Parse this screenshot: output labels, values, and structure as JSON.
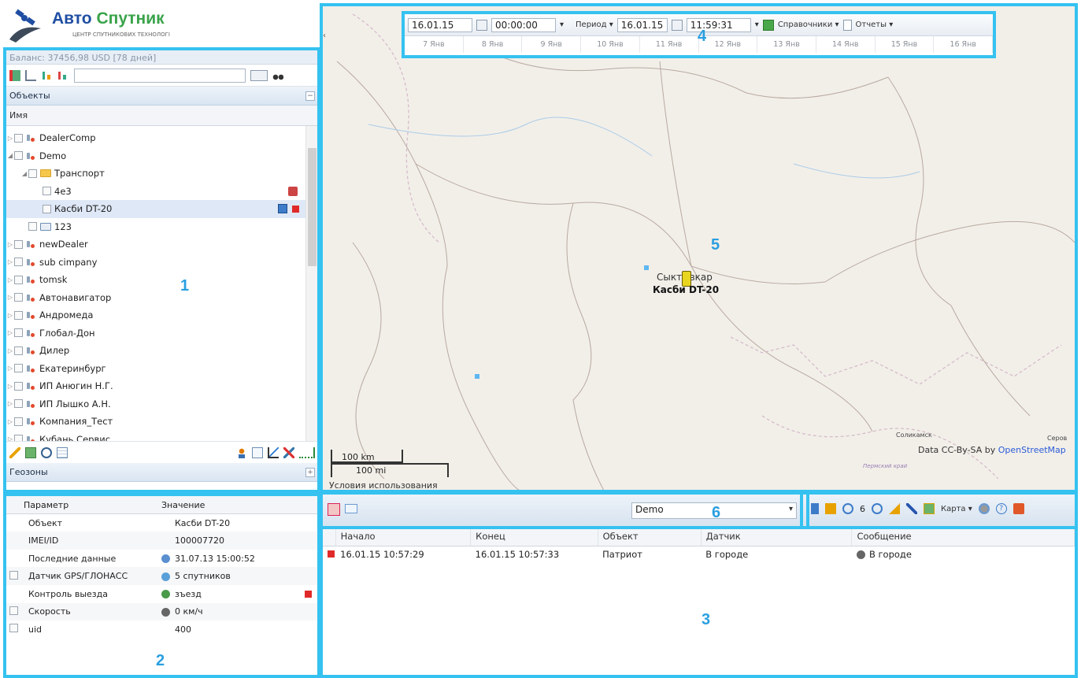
{
  "logo": {
    "brand_a": "Авто",
    "brand_b": "Спутник",
    "tagline": "ЦЕНТР СПУТНИКОВИХ ТЕХНОЛОГІ"
  },
  "left_panel": {
    "balance": "Баланс: 37456,98 USD [78 дней]",
    "objects_header": "Объекты",
    "column_name": "Имя",
    "geozones_header": "Геозоны",
    "tree": [
      {
        "label": "DealerComp",
        "level": 0,
        "arrow": "▷",
        "icon": "object"
      },
      {
        "label": "Demo",
        "level": 0,
        "arrow": "◢",
        "icon": "object"
      },
      {
        "label": "Транспорт",
        "level": 1,
        "arrow": "◢",
        "icon": "folder"
      },
      {
        "label": "4e3",
        "level": 2,
        "arrow": "",
        "icon": "none"
      },
      {
        "label": "Касби DT-20",
        "level": 2,
        "arrow": "",
        "icon": "none",
        "selected": true
      },
      {
        "label": "123",
        "level": 1,
        "arrow": "",
        "icon": "list"
      },
      {
        "label": "newDealer",
        "level": 0,
        "arrow": "▷",
        "icon": "object"
      },
      {
        "label": "sub cimpany",
        "level": 0,
        "arrow": "▷",
        "icon": "object"
      },
      {
        "label": "tomsk",
        "level": 0,
        "arrow": "▷",
        "icon": "object"
      },
      {
        "label": "Автонавигатор",
        "level": 0,
        "arrow": "▷",
        "icon": "object"
      },
      {
        "label": "Андромеда",
        "level": 0,
        "arrow": "▷",
        "icon": "object"
      },
      {
        "label": "Глобал-Дон",
        "level": 0,
        "arrow": "▷",
        "icon": "object"
      },
      {
        "label": "Дилер",
        "level": 0,
        "arrow": "▷",
        "icon": "object"
      },
      {
        "label": "Екатеринбург",
        "level": 0,
        "arrow": "▷",
        "icon": "object"
      },
      {
        "label": "ИП Анюгин Н.Г.",
        "level": 0,
        "arrow": "▷",
        "icon": "object"
      },
      {
        "label": "ИП Лышко А.Н.",
        "level": 0,
        "arrow": "▷",
        "icon": "object"
      },
      {
        "label": "Компания_Тест",
        "level": 0,
        "arrow": "▷",
        "icon": "object"
      },
      {
        "label": "Кубань Сервис",
        "level": 0,
        "arrow": "▷",
        "icon": "object"
      }
    ]
  },
  "params": {
    "col_param": "Параметр",
    "col_value": "Значение",
    "rows": [
      {
        "name": "Объект",
        "value": "Касби DT-20",
        "check": false
      },
      {
        "name": "IMEI/ID",
        "value": "100007720",
        "check": false
      },
      {
        "name": "Последние данные",
        "value": "31.07.13 15:00:52",
        "check": false
      },
      {
        "name": "Датчик GPS/ГЛОНАСС",
        "value": "5 спутников",
        "check": true
      },
      {
        "name": "Контроль выезда",
        "value": "зъезд",
        "check": false
      },
      {
        "name": "Скорость",
        "value": "0 км/ч",
        "check": true
      },
      {
        "name": "uid",
        "value": "400",
        "check": true
      }
    ]
  },
  "datebar": {
    "date_from": "16.01.15",
    "time_from": "00:00:00",
    "period": "Период",
    "date_to": "16.01.15",
    "time_to": "11:59:31",
    "directories": "Справочники",
    "reports": "Отчеты",
    "days": [
      "7 Янв",
      "8 Янв",
      "9 Янв",
      "10 Янв",
      "11 Янв",
      "12 Янв",
      "13 Янв",
      "14 Янв",
      "15 Янв",
      "16 Янв"
    ]
  },
  "map": {
    "city": "Сыктывкар",
    "vehicle": "Касби DT-20",
    "scale_km": "100 km",
    "scale_mi": "100 mi",
    "terms": "Условия использования",
    "attribution_prefix": "Data CC-By-SA by ",
    "attribution_link": "OpenStreetMap",
    "place1": "Соликамск",
    "place2": "Серов",
    "place3": "Пермский край"
  },
  "events": {
    "object_select": "Demo",
    "zoom_count": "6",
    "map_type": "Карта",
    "columns": [
      "Начало",
      "Конец",
      "Объект",
      "Датчик",
      "Сообщение"
    ],
    "rows": [
      {
        "start": "16.01.15 10:57:29",
        "end": "16.01.15 10:57:33",
        "object": "Патриот",
        "sensor": "В городе",
        "message": "В городе"
      }
    ]
  },
  "markers": {
    "m1": "1",
    "m2": "2",
    "m3": "3",
    "m4": "4",
    "m5": "5",
    "m6": "6"
  },
  "colors": {
    "highlight": "#35c2f0",
    "marker": "#2a9fe0",
    "brand_blue": "#1f4ea3",
    "brand_green": "#3aa34a",
    "event_red": "#e02a2a"
  }
}
